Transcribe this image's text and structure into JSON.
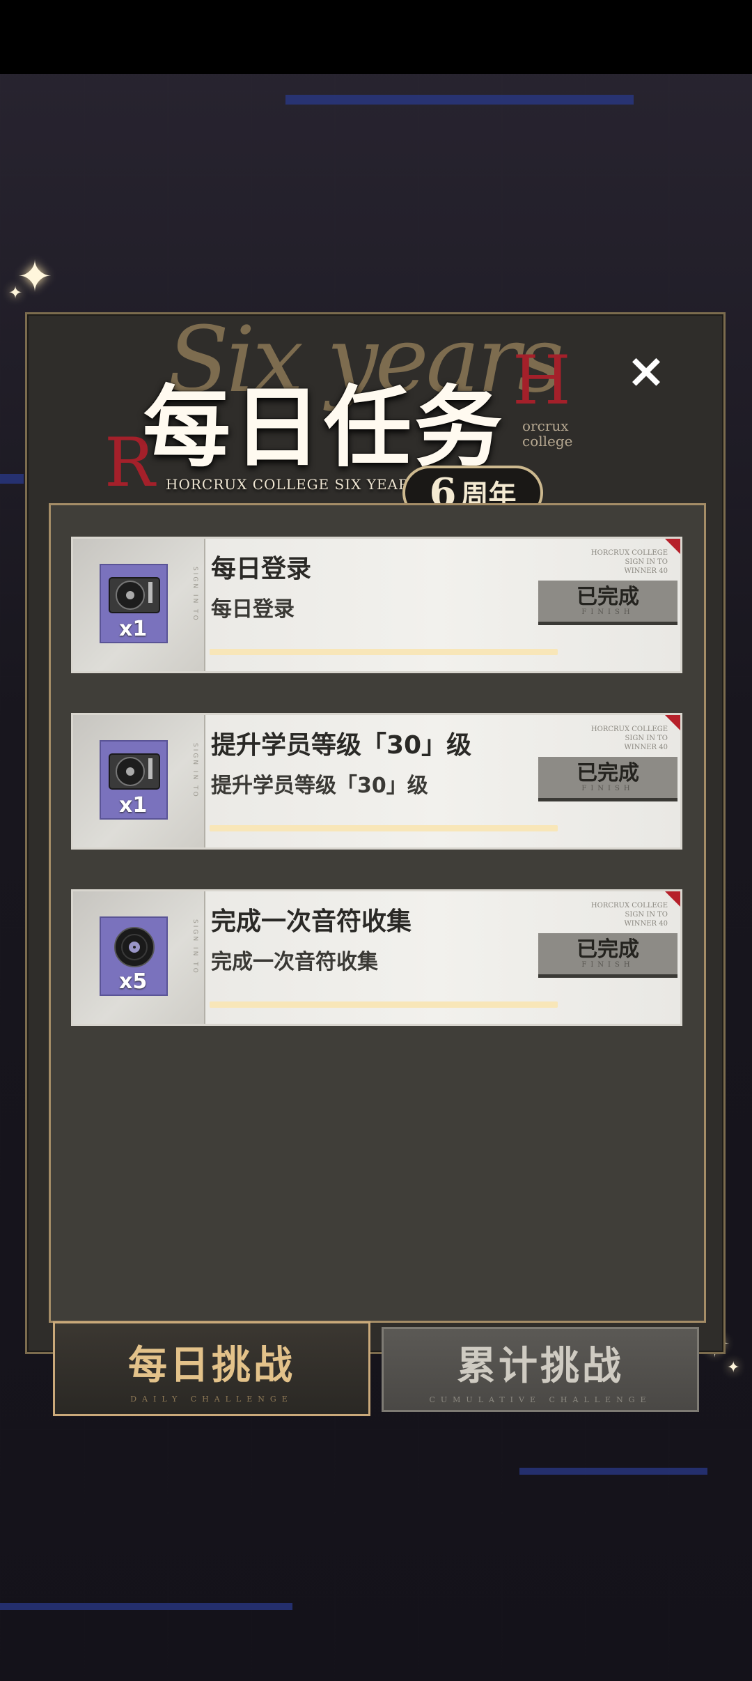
{
  "header": {
    "title": "每日任务",
    "subtitle_en": "HORCRUX COLLEGE SIX YEARS",
    "script_deco": "Six years",
    "side_deco": [
      "orcrux",
      "college"
    ],
    "badge_number": "6",
    "badge_text": "周年",
    "close_symbol": "×"
  },
  "tasks": [
    {
      "title": "每日登录",
      "description": "每日登录",
      "reward_icon": "turntable-icon",
      "reward_qty": "x1",
      "status_label": "已完成",
      "status_en": "FINISH",
      "meta": [
        "HORCRUX COLLEGE",
        "SIGN IN TO",
        "WINNER 40"
      ],
      "progress": 1.0
    },
    {
      "title": "提升学员等级「30」级",
      "description": "提升学员等级「30」级",
      "reward_icon": "turntable-icon",
      "reward_qty": "x1",
      "status_label": "已完成",
      "status_en": "FINISH",
      "meta": [
        "HORCRUX COLLEGE",
        "SIGN IN TO",
        "WINNER 40"
      ],
      "progress": 1.0
    },
    {
      "title": "完成一次音符收集",
      "description": "完成一次音符收集",
      "reward_icon": "vinyl-record-icon",
      "reward_qty": "x5",
      "status_label": "已完成",
      "status_en": "FINISH",
      "meta": [
        "HORCRUX COLLEGE",
        "SIGN IN TO",
        "WINNER 40"
      ],
      "progress": 1.0
    }
  ],
  "tabs": {
    "daily": {
      "label": "每日挑战",
      "en": "DAILY CHALLENGE",
      "active": true
    },
    "cumulative": {
      "label": "累计挑战",
      "en": "CUMULATIVE CHALLENGE",
      "active": false
    }
  },
  "colors": {
    "accent_gold": "#caa97a",
    "reward_bg": "#7a72bd",
    "corner_red": "#b6202a"
  }
}
